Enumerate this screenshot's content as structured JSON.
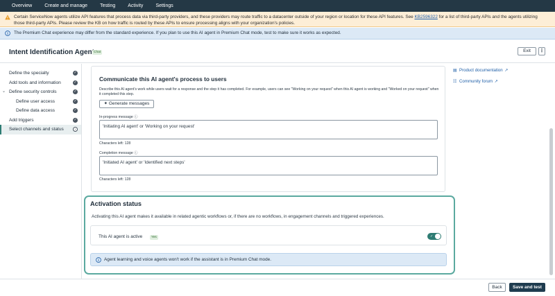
{
  "topnav": {
    "items": [
      "Overview",
      "Create and manage",
      "Testing",
      "Activity",
      "Settings"
    ]
  },
  "warning": {
    "text_before": "Certain ServiceNow agents utilize API features that process data via third-party providers, and these providers may route traffic to a datacenter outside of your region or location for these API features. See ",
    "link": "KB2596322",
    "text_after": " for a list of third-party APIs and the agents utilizing those third-party APIs. Please review the KB on how traffic is routed by these APIs to ensure processing aligns with your organization's policies."
  },
  "info_banner": "The Premium Chat experience may differ from the standard experience. If you plan to use this AI agent in Premium Chat mode, test to make sure it works as expected.",
  "header": {
    "title": "Intent Identification Agent",
    "badge": "Chat",
    "exit_label": "Exit",
    "more_label": "⋮"
  },
  "sidebar": {
    "items": [
      {
        "label": "Define the specialty"
      },
      {
        "label": "Add tools and information"
      },
      {
        "label": "Define security controls"
      },
      {
        "label": "Define user access"
      },
      {
        "label": "Define data access"
      },
      {
        "label": "Add triggers"
      },
      {
        "label": "Select channels and status"
      }
    ]
  },
  "communicate": {
    "title": "Communicate this AI agent's process to users",
    "description": "Describe this AI agent's work while users wait for a response and the step it has completed. For example, users can see \"Working on your request\" when this AI agent is working and \"Worked on your request\" when it completed this step.",
    "generate_label": "Generate messages",
    "in_progress_label": "In-progress message",
    "in_progress_placeholder": "'Initiating AI agent' or 'Working on your request'",
    "in_progress_chars": "Characters left: 128",
    "completion_label": "Completion message",
    "completion_placeholder": "'Initiated AI agent' or 'Identified next steps'",
    "completion_chars": "Characters left: 128"
  },
  "activation": {
    "title": "Activation status",
    "description": "Activating this AI agent makes it available in related agentic workflows or, if there are no workflows, in engagement channels and triggered experiences.",
    "row_label": "This AI agent is active",
    "yes_badge": "Yes",
    "active": true,
    "note": "Agent learning and voice agents won't work if the assistant is in Premium Chat mode."
  },
  "right_links": {
    "product_docs": "Product documentation",
    "community": "Community forum"
  },
  "footer": {
    "back_label": "Back",
    "save_label": "Save and test"
  },
  "colors": {
    "nav": "#243845",
    "accent": "#2e7c73",
    "primary_button": "#1f3c4f",
    "warning_bg": "#fdeed7",
    "info_bg": "#dce9f6"
  }
}
